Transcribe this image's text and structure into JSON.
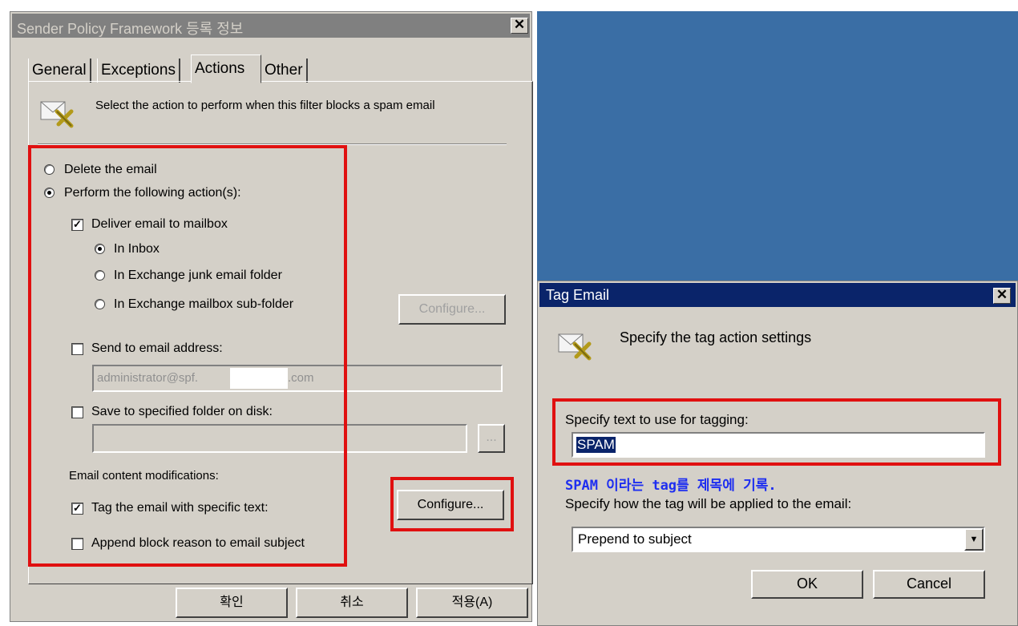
{
  "filter_dialog": {
    "title": "Sender Policy Framework 등록 정보",
    "close": "✕",
    "tabs": [
      "General",
      "Exceptions",
      "Actions",
      "Other"
    ],
    "selected_tab": "Actions",
    "header_text": "Select the action to perform when this filter blocks a spam email",
    "options": {
      "delete_email": {
        "label": "Delete the email",
        "selected": false
      },
      "perform_actions": {
        "label": "Perform the following action(s):",
        "selected": true
      },
      "deliver_to_mailbox": {
        "label": "Deliver email to mailbox",
        "checked": true
      },
      "in_inbox": {
        "label": "In Inbox",
        "selected": true
      },
      "in_junk": {
        "label": "In Exchange junk email folder",
        "selected": false
      },
      "in_subfolder": {
        "label": "In Exchange mailbox sub-folder",
        "selected": false
      },
      "configure_subfolder": "Configure...",
      "send_to_address": {
        "label": "Send to email address:",
        "checked": false
      },
      "address_value_left": "administrator@spf.",
      "address_value_right": ".com",
      "save_to_folder": {
        "label": "Save to specified folder on disk:",
        "checked": false
      },
      "folder_value": "",
      "browse": "...",
      "content_mods_label": "Email content modifications:",
      "tag_email": {
        "label": "Tag the email with specific text:",
        "checked": true
      },
      "configure_tag": "Configure...",
      "append_reason": {
        "label": "Append block reason to email subject",
        "checked": false
      }
    },
    "buttons": {
      "ok": "확인",
      "cancel": "취소",
      "apply": "적용(A)"
    }
  },
  "tag_dialog": {
    "title": "Tag Email",
    "close": "✕",
    "header_text": "Specify the tag action settings",
    "tag_text_label": "Specify text to use for tagging:",
    "tag_text_value": "SPAM",
    "annotation": "SPAM 이라는 tag를 제목에 기록.",
    "apply_label": "Specify how the tag will be applied to the email:",
    "apply_selected": "Prepend to subject",
    "dropdown_arrow": "▼",
    "ok": "OK",
    "cancel": "Cancel"
  },
  "colors": {
    "highlight": "#e01010",
    "annotation": "#1e2ef0",
    "title_active": "#0a246a",
    "desktop": "#3a6ea5"
  }
}
